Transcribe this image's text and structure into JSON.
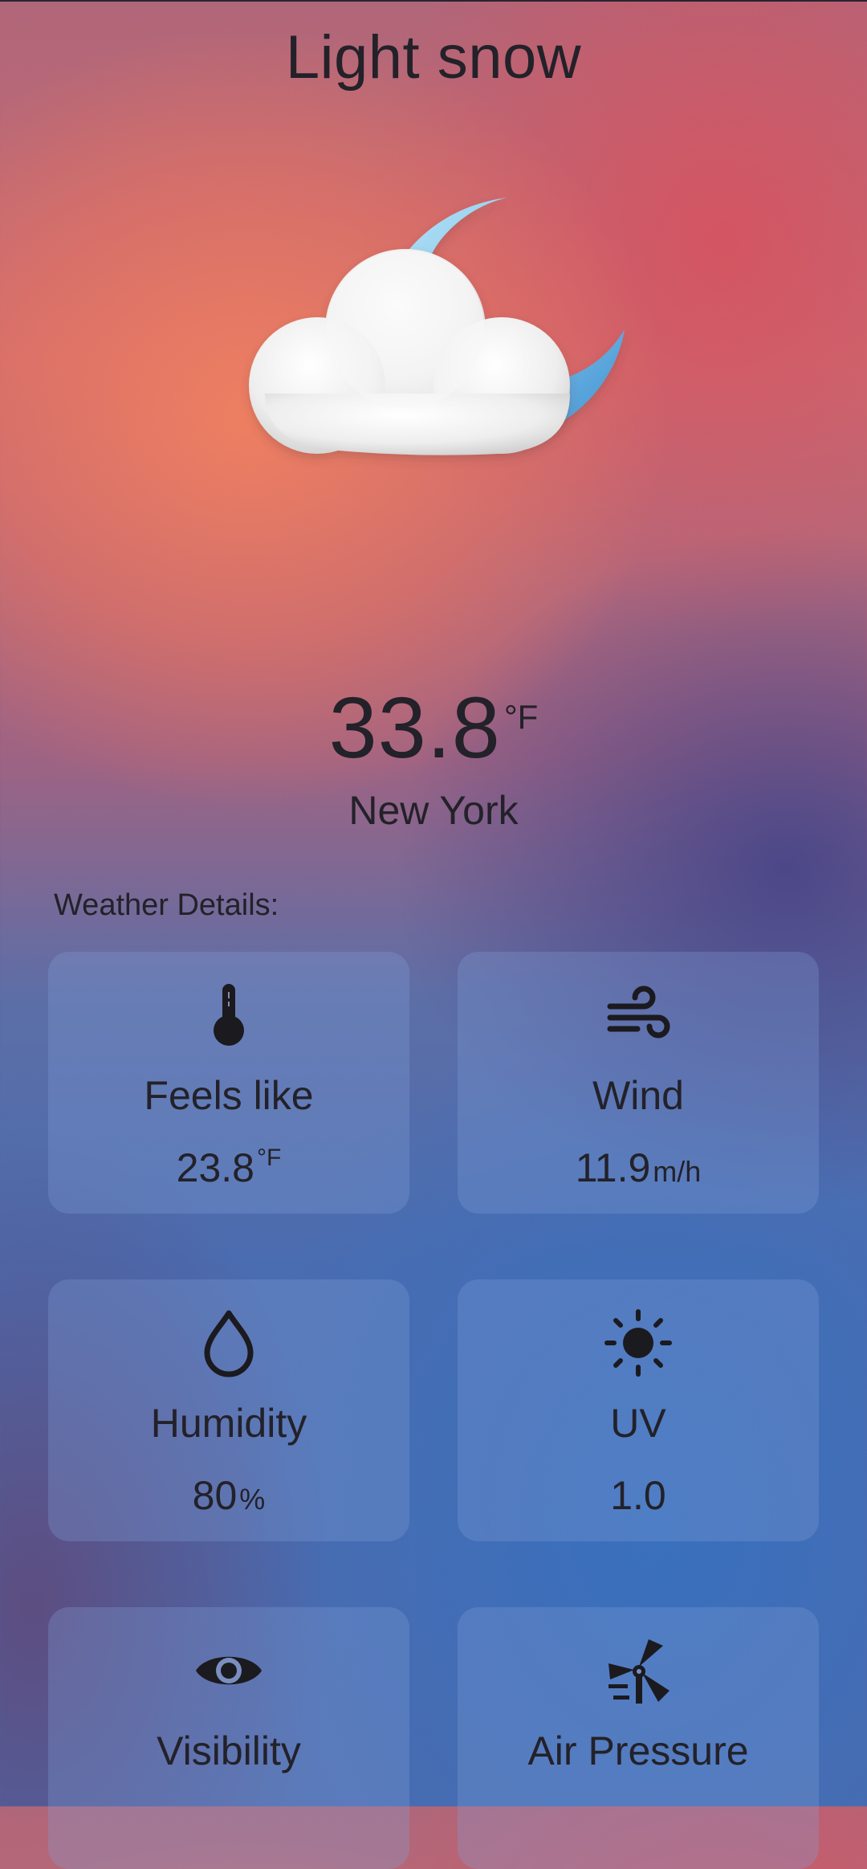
{
  "header": {
    "condition": "Light snow"
  },
  "hero_icon": "moon-cloud-icon",
  "current": {
    "temperature": "33.8",
    "temperature_unit": "°F",
    "city": "New York"
  },
  "details": {
    "title": "Weather Details:",
    "cards": [
      {
        "label": "Feels like",
        "value": "23.8",
        "unit": "°F",
        "icon": "thermometer-icon"
      },
      {
        "label": "Wind",
        "value": "11.9",
        "unit": "m/h",
        "icon": "wind-icon"
      },
      {
        "label": "Humidity",
        "value": "80",
        "unit": "%",
        "icon": "water-drop-icon"
      },
      {
        "label": "UV",
        "value": "1.0",
        "unit": "",
        "icon": "sun-icon"
      },
      {
        "label": "Visibility",
        "value": "",
        "unit": "",
        "icon": "eye-icon"
      },
      {
        "label": "Air Pressure",
        "value": "",
        "unit": "",
        "icon": "barometer-icon"
      }
    ]
  },
  "colors": {
    "text": "#232129",
    "card_background": "rgba(130,160,215,0.30)"
  }
}
